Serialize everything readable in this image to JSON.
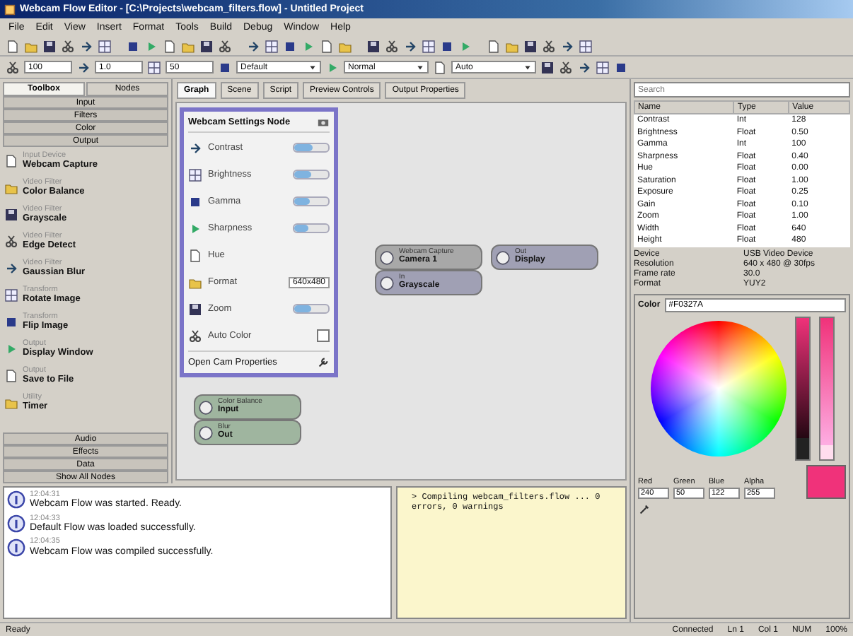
{
  "window": {
    "title": "Webcam Flow Editor - [C:\\Projects\\webcam_filters.flow] - Untitled Project"
  },
  "menu": [
    "File",
    "Edit",
    "View",
    "Insert",
    "Format",
    "Tools",
    "Build",
    "Debug",
    "Window",
    "Help"
  ],
  "toolbar_fields": [
    {
      "kind": "field",
      "value": "100"
    },
    {
      "kind": "field",
      "value": "1.0"
    },
    {
      "kind": "field",
      "value": "50"
    },
    {
      "kind": "dropdown",
      "value": "Default"
    },
    {
      "kind": "dropdown",
      "value": "Normal"
    },
    {
      "kind": "dropdown",
      "value": "Auto"
    }
  ],
  "left_tabs": [
    {
      "label": "Toolbox",
      "selected": true
    },
    {
      "label": "Nodes",
      "selected": false
    }
  ],
  "categories": [
    "Input",
    "Filters",
    "Color",
    "Output"
  ],
  "node_list": [
    {
      "caption": "Input Device",
      "name": "Webcam Capture"
    },
    {
      "caption": "Video Filter",
      "name": "Color Balance"
    },
    {
      "caption": "Video Filter",
      "name": "Grayscale"
    },
    {
      "caption": "Video Filter",
      "name": "Edge Detect"
    },
    {
      "caption": "Video Filter",
      "name": "Gaussian Blur"
    },
    {
      "caption": "Transform",
      "name": "Rotate Image"
    },
    {
      "caption": "Transform",
      "name": "Flip Image"
    },
    {
      "caption": "Output",
      "name": "Display Window"
    },
    {
      "caption": "Output",
      "name": "Save to File"
    },
    {
      "caption": "Utility",
      "name": "Timer"
    }
  ],
  "bottom_categories": [
    "Audio",
    "Effects",
    "Data",
    "Show All Nodes"
  ],
  "doc_tabs": [
    {
      "label": "Graph",
      "selected": true
    },
    {
      "label": "Scene",
      "selected": false
    },
    {
      "label": "Script",
      "selected": false
    },
    {
      "label": "Preview Controls",
      "selected": false
    },
    {
      "label": "Output Properties",
      "selected": false
    }
  ],
  "settings_panel": {
    "title": "Webcam Settings Node",
    "rows": [
      {
        "kind": "slider",
        "label": "Contrast",
        "level": 0.55
      },
      {
        "kind": "slider",
        "label": "Brightness",
        "level": 0.5
      },
      {
        "kind": "slider",
        "label": "Gamma",
        "level": 0.45
      },
      {
        "kind": "slider",
        "label": "Sharpness",
        "level": 0.4
      },
      {
        "kind": "plain",
        "label": "Hue"
      },
      {
        "kind": "dropdown",
        "label": "Format",
        "value": "640x480"
      },
      {
        "kind": "slider",
        "label": "Zoom",
        "level": 0.5
      },
      {
        "kind": "checkbox",
        "label": "Auto Color",
        "checked": false
      }
    ],
    "footer": "Open Cam Properties"
  },
  "canvas_nodes": [
    {
      "caption": "Webcam Capture",
      "name": "Camera 1",
      "color": "#a8a8a8"
    },
    {
      "caption": "Out",
      "name": "Display",
      "color": "#a0a0b4"
    },
    {
      "caption": "In",
      "name": "Grayscale",
      "color": "#a0a0b4"
    },
    {
      "caption": "Color Balance",
      "name": "Input",
      "color": "#9fb59f"
    },
    {
      "caption": "Blur",
      "name": "Out",
      "color": "#9fb59f"
    }
  ],
  "search": {
    "placeholder": "Search"
  },
  "table": {
    "columns": [
      "Name",
      "Type",
      "Value"
    ],
    "rows": [
      [
        "Contrast",
        "Int",
        "128"
      ],
      [
        "Brightness",
        "Float",
        "0.50"
      ],
      [
        "Gamma",
        "Int",
        "100"
      ],
      [
        "Sharpness",
        "Float",
        "0.40"
      ],
      [
        "Hue",
        "Float",
        "0.00"
      ],
      [
        "Saturation",
        "Float",
        "1.00"
      ],
      [
        "Exposure",
        "Float",
        "0.25"
      ],
      [
        "Gain",
        "Float",
        "0.10"
      ],
      [
        "Zoom",
        "Float",
        "1.00"
      ],
      [
        "Width",
        "Float",
        "640"
      ],
      [
        "Height",
        "Float",
        "480"
      ]
    ]
  },
  "properties": [
    [
      "Device",
      "USB Video Device"
    ],
    [
      "Resolution",
      "640 x 480 @ 30fps"
    ],
    [
      "Frame rate",
      "30.0"
    ],
    [
      "Format",
      "YUY2"
    ]
  ],
  "color_picker": {
    "label": "Color",
    "value": "#F0327A",
    "channels": [
      {
        "label": "Red",
        "value": "240"
      },
      {
        "label": "Green",
        "value": "50"
      },
      {
        "label": "Blue",
        "value": "122"
      },
      {
        "label": "Alpha",
        "value": "255"
      }
    ],
    "color": "#f0327a",
    "brightness_slider": {
      "level": 0.15
    },
    "alpha_slider": {
      "level": 0.1
    }
  },
  "log": [
    {
      "time": "12:04:31",
      "text": "Webcam Flow was started. Ready."
    },
    {
      "time": "12:04:33",
      "text": "Default Flow was loaded successfully."
    },
    {
      "time": "12:04:35",
      "text": "Webcam Flow was compiled successfully."
    }
  ],
  "output": [
    "> Compiling webcam_filters.flow ... 0 errors, 0 warnings"
  ],
  "status": {
    "left": "Ready",
    "items": [
      "Connected",
      "Ln 1",
      "Col 1",
      "NUM",
      "100%"
    ]
  }
}
